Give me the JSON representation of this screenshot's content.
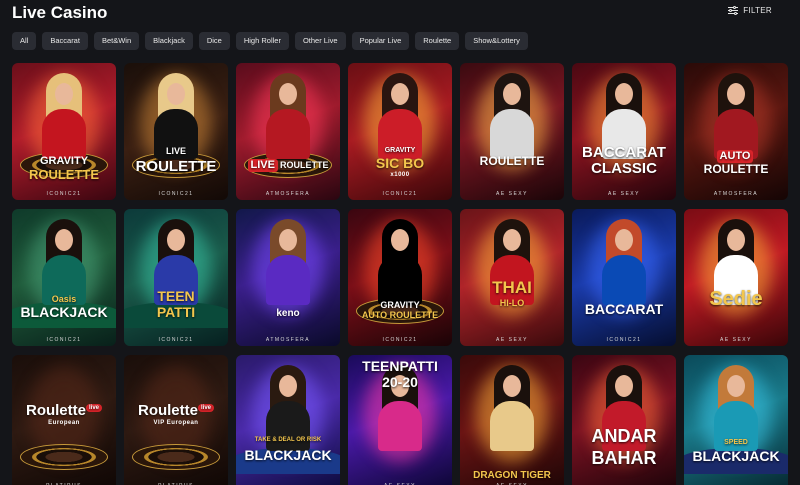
{
  "header": {
    "title": "Live Casino",
    "filter_label": "FILTER"
  },
  "categories": [
    "All",
    "Baccarat",
    "Bet&Win",
    "Blackjack",
    "Dice",
    "High Roller",
    "Other Live",
    "Popular Live",
    "Roulette",
    "Show&Lottery"
  ],
  "games": [
    {
      "title_line1": "GRAVITY",
      "title_line2": "ROULETTE",
      "provider": "ICONIC21"
    },
    {
      "title_line1": "LIVE",
      "title_line2": "ROULETTE",
      "provider": "ICONIC21"
    },
    {
      "badge": "LIVE",
      "title_line2": "ROULETTE",
      "provider": "ATMOSFERA"
    },
    {
      "title_line1": "GRAVITY",
      "title_line2": "SIC BO",
      "sub": "x1000",
      "provider": "ICONIC21"
    },
    {
      "title_line2": "ROULETTE",
      "provider": "AE SEXY"
    },
    {
      "title_line1": "BACCARAT",
      "title_line2": "CLASSIC",
      "provider": "AE SEXY"
    },
    {
      "badge": "AUTO",
      "title_line2": "ROULETTE",
      "provider": "ATMOSFERA"
    },
    {
      "title_line1": "Oasis",
      "title_line2": "BLACKJACK",
      "provider": "ICONIC21"
    },
    {
      "title_line1": "TEEN",
      "title_line2": "PATTI",
      "provider": "ICONIC21"
    },
    {
      "title_line2": "keno",
      "provider": "ATMOSFERA"
    },
    {
      "title_line1": "GRAVITY",
      "title_line2": "AUTO ROULETTE",
      "provider": "ICONIC21"
    },
    {
      "title_line1": "THAI",
      "title_line2": "HI-LO",
      "provider": "AE SEXY"
    },
    {
      "title_line2": "BACCARAT",
      "provider": "ICONIC21"
    },
    {
      "title_line2": "Sedie",
      "provider": "AE SEXY"
    },
    {
      "title_line1": "Roulette",
      "live_tag": "live",
      "sub": "European",
      "provider": "PLATIPUS"
    },
    {
      "title_line1": "Roulette",
      "live_tag": "live",
      "sub": "VIP European",
      "provider": "PLATIPUS"
    },
    {
      "title_line1": "TAKE & DEAL OR RISK",
      "title_line2": "BLACKJACK",
      "provider": ""
    },
    {
      "title_line1": "TEENPATTI",
      "title_line2": "20-20",
      "provider": "AE SEXY"
    },
    {
      "title_line2": "DRAGON TIGER",
      "provider": "AE SEXY"
    },
    {
      "title_line1": "ANDAR",
      "title_line2": "BAHAR",
      "provider": ""
    },
    {
      "title_line1": "SPEED",
      "title_line2": "BLACKJACK",
      "provider": ""
    }
  ],
  "colors": {
    "background": "#141519",
    "chip": "#2a2c33",
    "live_red": "#d9242a",
    "gold": "#e3b24a"
  }
}
